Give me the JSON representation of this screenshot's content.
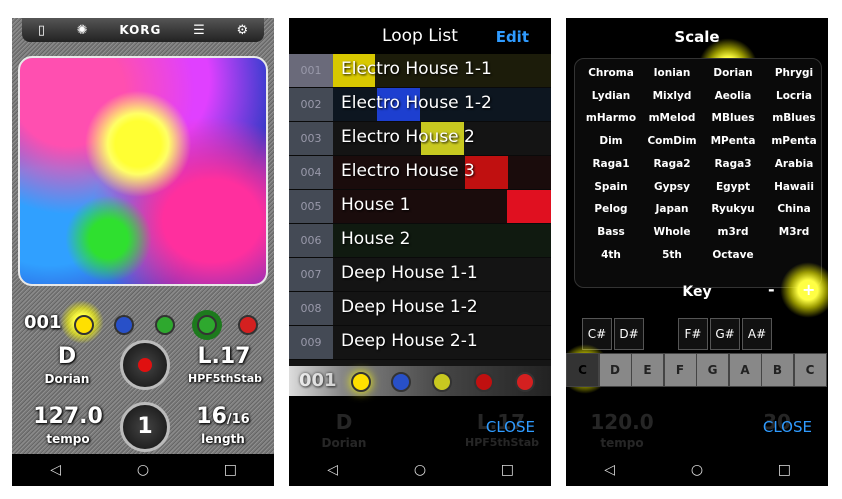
{
  "panel1": {
    "toolbar": {
      "icons": [
        "file-icon",
        "sync-icon",
        "brand",
        "list-icon",
        "gear-icon"
      ],
      "brand": "KORG"
    },
    "loop_number": "001",
    "key": "D",
    "scale": "Dorian",
    "sound_code": "L.17",
    "sound_name": "HPF5thStab",
    "tempo_value": "127.0",
    "tempo_label": "tempo",
    "length_value": "16",
    "length_denom": "/16",
    "length_label": "length",
    "play_count": "1"
  },
  "panel2": {
    "title": "Loop List",
    "edit_label": "Edit",
    "close_label": "CLOSE",
    "rows": [
      {
        "num": "001",
        "name": "Electro House 1-1"
      },
      {
        "num": "002",
        "name": "Electro House 1-2"
      },
      {
        "num": "003",
        "name": "Electro House 2"
      },
      {
        "num": "004",
        "name": "Electro House 3"
      },
      {
        "num": "005",
        "name": "House 1"
      },
      {
        "num": "006",
        "name": "House 2"
      },
      {
        "num": "007",
        "name": "Deep House 1-1"
      },
      {
        "num": "008",
        "name": "Deep House 1-2"
      },
      {
        "num": "009",
        "name": "Deep House 2-1"
      }
    ],
    "bottom_number": "001",
    "bottom_key": "D",
    "bottom_scale": "Dorian",
    "bottom_sound": "L.17",
    "bottom_sound_name": "HPF5thStab"
  },
  "panel3": {
    "title": "Scale",
    "scales": [
      "Chroma",
      "Ionian",
      "Dorian",
      "Phrygi",
      "Lydian",
      "Mixlyd",
      "Aeolia",
      "Locria",
      "mHarmo",
      "mMelod",
      "MBlues",
      "mBlues",
      "Dim",
      "ComDim",
      "MPenta",
      "mPenta",
      "Raga1",
      "Raga2",
      "Raga3",
      "Arabia",
      "Spain",
      "Gypsy",
      "Egypt",
      "Hawaii",
      "Pelog",
      "Japan",
      "Ryukyu",
      "China",
      "Bass",
      "Whole",
      "m3rd",
      "M3rd",
      "4th",
      "5th",
      "Octave"
    ],
    "key_label": "Key",
    "minus": "-",
    "plus": "+",
    "black_keys": [
      "C#",
      "D#",
      "F#",
      "G#",
      "A#"
    ],
    "white_keys": [
      "C",
      "D",
      "E",
      "F",
      "G",
      "A",
      "B",
      "C"
    ],
    "tempo_value": "120.0",
    "tempo_label": "tempo",
    "length_value": "30",
    "close_label": "CLOSE"
  },
  "nav": {
    "back": "◁",
    "home": "○",
    "recent": "□"
  }
}
